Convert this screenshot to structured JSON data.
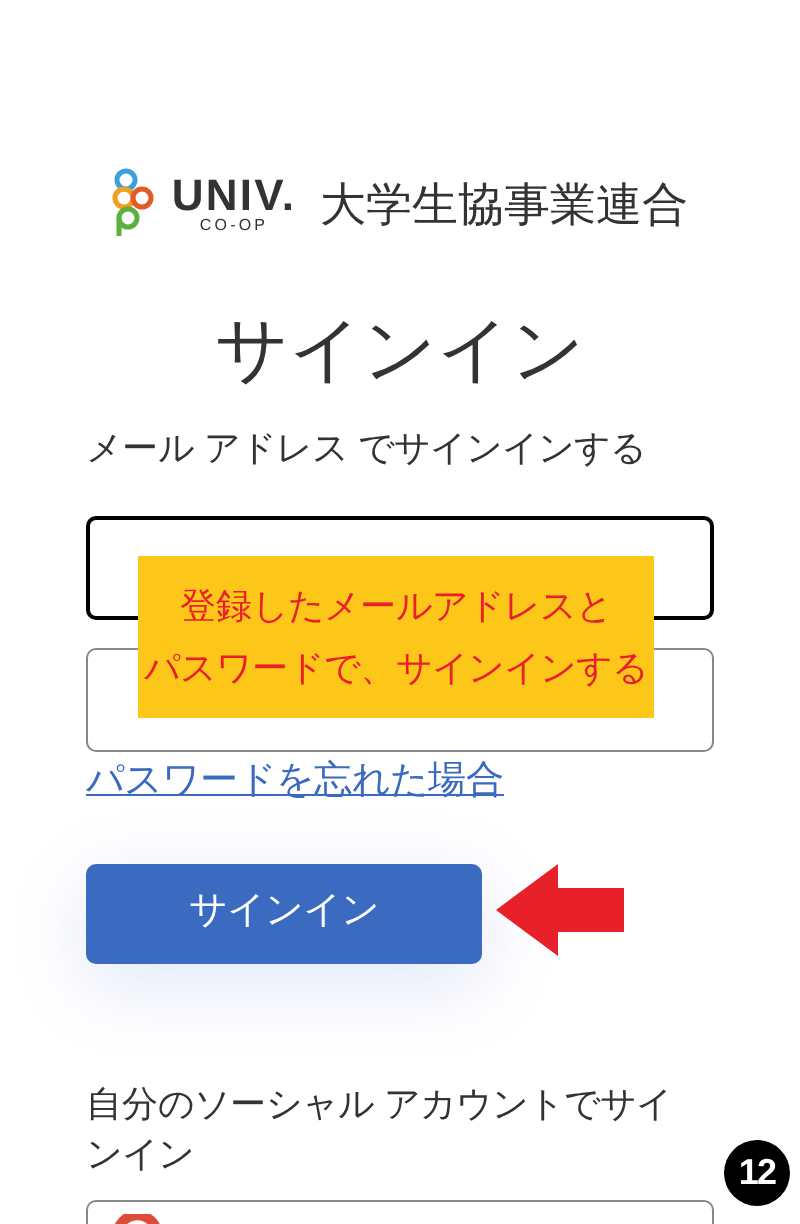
{
  "logo": {
    "wordmark": "UNIV.",
    "sub": "CO-OP",
    "org": "大学生協事業連合"
  },
  "title": "サインイン",
  "email_section": {
    "label": "メール アドレス でサインインする"
  },
  "fields": [
    {
      "focused": true
    },
    {
      "focused": false
    }
  ],
  "forgot_link": "パスワードを忘れた場合",
  "sign_in_button": "サインイン",
  "social": {
    "label": "自分のソーシャル アカウントでサインイン",
    "buttons": [
      {
        "kind": "google"
      }
    ]
  },
  "callout": {
    "lines": [
      "登録したメールアドレスと",
      "パスワードで、サインインする"
    ]
  },
  "step_badge": "12"
}
